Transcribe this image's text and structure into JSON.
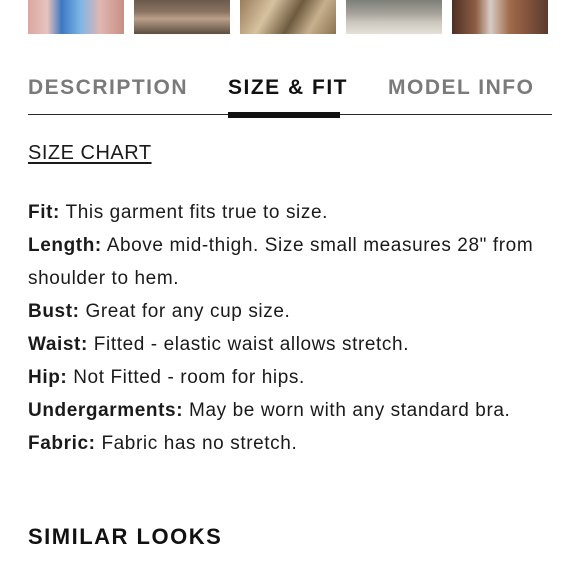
{
  "tabs": {
    "description": "DESCRIPTION",
    "size_fit": "SIZE & FIT",
    "model_info": "MODEL INFO",
    "active": "size_fit"
  },
  "size_chart_link": "SIZE CHART",
  "specs": [
    {
      "label": "Fit:",
      "text": "This garment fits true to size."
    },
    {
      "label": "Length:",
      "text": "Above mid-thigh. Size small measures 28\" from shoulder to hem."
    },
    {
      "label": "Bust:",
      "text": "Great for any cup size."
    },
    {
      "label": "Waist:",
      "text": "Fitted - elastic waist allows stretch."
    },
    {
      "label": "Hip:",
      "text": "Not Fitted - room for hips."
    },
    {
      "label": "Undergarments:",
      "text": "May be worn with any standard bra."
    },
    {
      "label": "Fabric:",
      "text": "Fabric has no stretch."
    }
  ],
  "similar_looks_heading": "SIMILAR LOOKS"
}
